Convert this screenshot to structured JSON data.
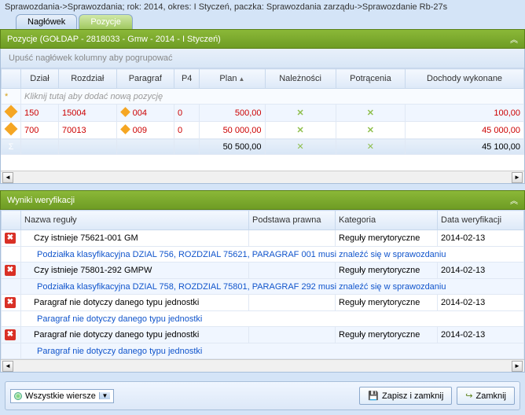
{
  "breadcrumb": "Sprawozdania->Sprawozdania; rok: 2014, okres: I Styczeń, paczka: Sprawozdania zarządu->Sprawozdanie Rb-27s",
  "tabs": {
    "header": "Nagłówek",
    "positions": "Pozycje"
  },
  "positions_panel": {
    "title": "Pozycje  (GOŁDAP - 2818033 - Gmw - 2014 - I Styczeń)"
  },
  "group_hint": "Upuść nagłówek kolumny aby pogrupować",
  "cols": {
    "dzial": "Dział",
    "rozdzial": "Rozdział",
    "paragraf": "Paragraf",
    "p4": "P4",
    "plan": "Plan",
    "naleznosci": "Należności",
    "potracenia": "Potrącenia",
    "dochody": "Dochody wykonane"
  },
  "new_row_hint": "Kliknij tutaj aby dodać nową pozycję",
  "rows": [
    {
      "dzial": "150",
      "rozdzial": "15004",
      "paragraf": "004",
      "p4": "0",
      "plan": "500,00",
      "dochody": "100,00"
    },
    {
      "dzial": "700",
      "rozdzial": "70013",
      "paragraf": "009",
      "p4": "0",
      "plan": "50 000,00",
      "dochody": "45 000,00"
    }
  ],
  "sum": {
    "plan": "50 500,00",
    "dochody": "45 100,00"
  },
  "verify_panel": {
    "title": "Wyniki weryfikacji"
  },
  "vcols": {
    "name": "Nazwa reguły",
    "basis": "Podstawa prawna",
    "cat": "Kategoria",
    "date": "Data weryfikacji"
  },
  "vrows": [
    {
      "name": "Czy istnieje 75621-001 GM",
      "cat": "Reguły merytoryczne",
      "date": "2014-02-13",
      "detail": "Podziałka klasyfikacyjna DZIAL 756, ROZDZIAL 75621, PARAGRAF 001 musi znaleźć się w sprawozdaniu"
    },
    {
      "name": "Czy istnieje 75801-292 GMPW",
      "cat": "Reguły merytoryczne",
      "date": "2014-02-13",
      "detail": "Podziałka klasyfikacyjna DZIAL 758, ROZDZIAL 75801, PARAGRAF 292 musi znaleźć się w sprawozdaniu"
    },
    {
      "name": "Paragraf nie dotyczy danego typu jednostki",
      "cat": "Reguły merytoryczne",
      "date": "2014-02-13",
      "detail": "Paragraf nie dotyczy danego typu jednostki"
    },
    {
      "name": "Paragraf nie dotyczy danego typu jednostki",
      "cat": "Reguły merytoryczne",
      "date": "2014-02-13",
      "detail": "Paragraf nie dotyczy danego typu jednostki"
    }
  ],
  "footer": {
    "filter": "Wszystkie wiersze",
    "save": "Zapisz i zamknij",
    "close": "Zamknij"
  },
  "icons": {
    "star": "*",
    "sigma": "Σ",
    "x": "✕",
    "err": "✖",
    "chev": "︽",
    "left": "◄",
    "right": "►",
    "down": "▼",
    "save": "💾",
    "close": "↪"
  }
}
